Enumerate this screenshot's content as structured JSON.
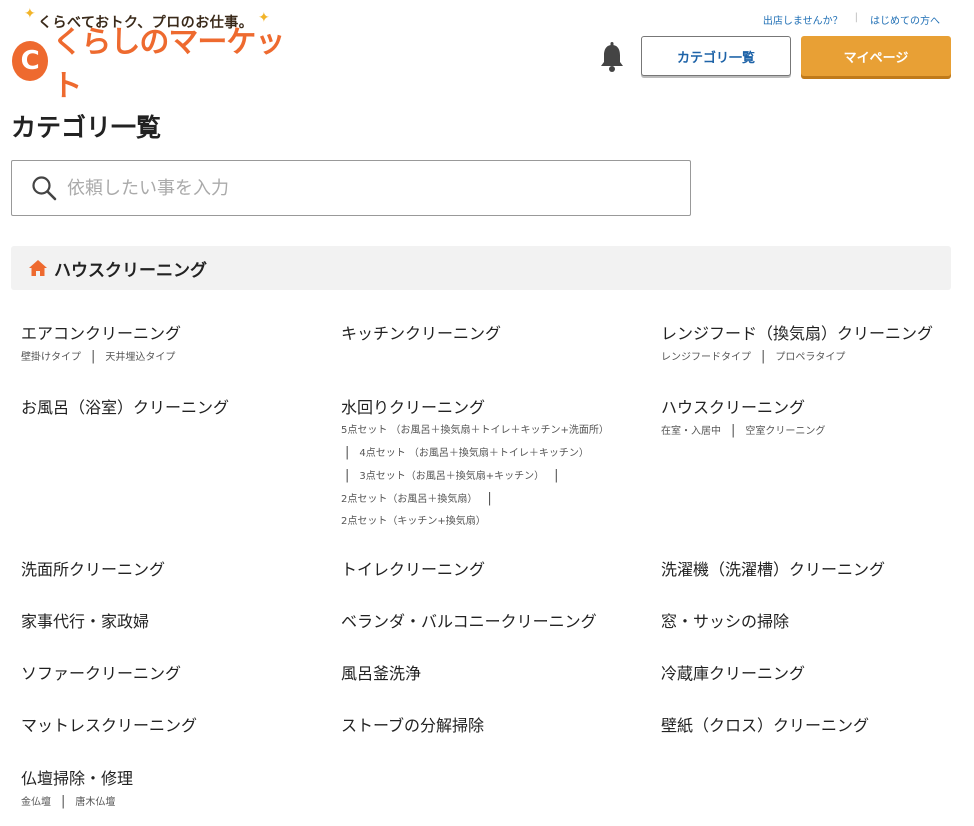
{
  "brand": {
    "tagline": "くらべておトク、プロのお仕事。",
    "logo_mark": "C",
    "name": "くらしのマーケット"
  },
  "top_links": [
    "出店しませんか？",
    "はじめての方へ"
  ],
  "header_buttons": {
    "category": "カテゴリ一覧",
    "mypage": "マイページ"
  },
  "page_title": "カテゴリ一覧",
  "search": {
    "placeholder": "依頼したい事を入力",
    "value": ""
  },
  "section": {
    "title": "ハウスクリーニング",
    "icon": "home-icon"
  },
  "categories": [
    {
      "name": "エアコンクリーニング",
      "subs": [
        "壁掛けタイプ",
        "天井埋込タイプ"
      ]
    },
    {
      "name": "キッチンクリーニング",
      "subs": []
    },
    {
      "name": "レンジフード（換気扇）クリーニング",
      "subs": [
        "レンジフードタイプ",
        "プロペラタイプ"
      ]
    },
    {
      "name": "お風呂（浴室）クリーニング",
      "subs": []
    },
    {
      "name": "水回りクリーニング",
      "subs": [
        "5点セット （お風呂＋換気扇＋トイレ＋キッチン+洗面所）",
        "4点セット （お風呂＋換気扇＋トイレ＋キッチン）",
        "3点セット（お風呂＋換気扇+キッチン）",
        "2点セット（お風呂＋換気扇）",
        "2点セット（キッチン+換気扇）"
      ]
    },
    {
      "name": "ハウスクリーニング",
      "subs": [
        "在室・入居中",
        "空室クリーニング"
      ]
    },
    {
      "name": "洗面所クリーニング",
      "subs": []
    },
    {
      "name": "トイレクリーニング",
      "subs": []
    },
    {
      "name": "洗濯機（洗濯槽）クリーニング",
      "subs": []
    },
    {
      "name": "家事代行・家政婦",
      "subs": []
    },
    {
      "name": "ベランダ・バルコニークリーニング",
      "subs": []
    },
    {
      "name": "窓・サッシの掃除",
      "subs": []
    },
    {
      "name": "ソファークリーニング",
      "subs": []
    },
    {
      "name": "風呂釜洗浄",
      "subs": []
    },
    {
      "name": "冷蔵庫クリーニング",
      "subs": []
    },
    {
      "name": "マットレスクリーニング",
      "subs": []
    },
    {
      "name": "ストーブの分解掃除",
      "subs": []
    },
    {
      "name": "壁紙（クロス）クリーニング",
      "subs": []
    },
    {
      "name": "仏壇掃除・修理",
      "subs": [
        "金仏壇",
        "唐木仏壇"
      ]
    }
  ],
  "colors": {
    "brand_orange": "#ee6a2f",
    "button_orange": "#e8a035",
    "link_blue": "#1f6fb5"
  }
}
